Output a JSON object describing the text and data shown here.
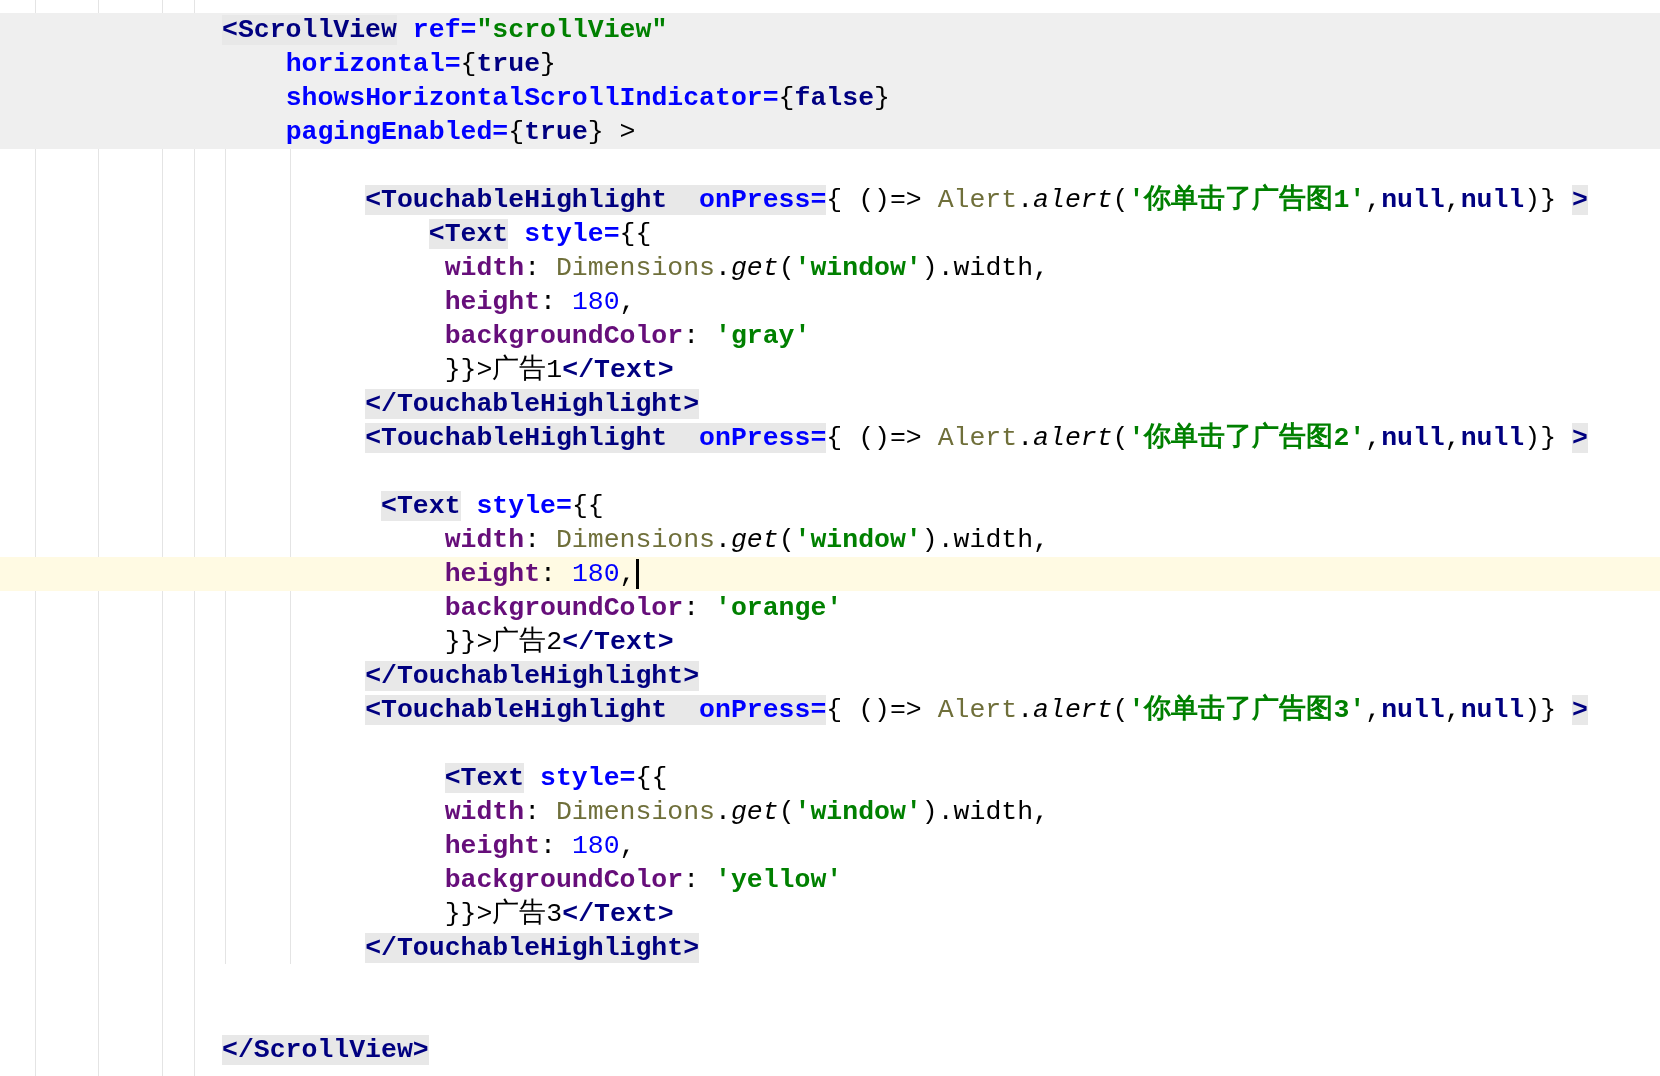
{
  "editor": {
    "lines": [
      {
        "current": false,
        "scope": true,
        "tokens": [
          {
            "kind": "tag",
            "t": "<ScrollView",
            "bg": true
          },
          {
            "kind": "attr",
            "t": " ref="
          },
          {
            "kind": "str",
            "t": "\"scrollView\""
          }
        ]
      },
      {
        "current": false,
        "scope": true,
        "tokens": [
          {
            "kind": "attr",
            "t": "    horizontal="
          },
          {
            "kind": "plain",
            "t": "{"
          },
          {
            "kind": "kw",
            "t": "true"
          },
          {
            "kind": "plain",
            "t": "}"
          }
        ]
      },
      {
        "current": false,
        "scope": true,
        "tokens": [
          {
            "kind": "attr",
            "t": "    showsHorizontalScrollIndicator="
          },
          {
            "kind": "plain",
            "t": "{"
          },
          {
            "kind": "kw",
            "t": "false"
          },
          {
            "kind": "plain",
            "t": "}"
          }
        ]
      },
      {
        "current": false,
        "scope": true,
        "tokens": [
          {
            "kind": "attr",
            "t": "    pagingEnabled="
          },
          {
            "kind": "plain",
            "t": "{"
          },
          {
            "kind": "kw",
            "t": "true"
          },
          {
            "kind": "plain",
            "t": "} >"
          }
        ]
      },
      {
        "current": false,
        "scope": false
      },
      {
        "current": false,
        "scope": false,
        "tokens": [
          {
            "kind": "tag",
            "t": "         <TouchableHighlight  ",
            "bg": true
          },
          {
            "kind": "attr",
            "t": "onPress=",
            "bg": true
          },
          {
            "kind": "plain",
            "t": "{ ()=> "
          },
          {
            "kind": "cls",
            "t": "Alert"
          },
          {
            "kind": "plain",
            "t": "."
          },
          {
            "kind": "method",
            "t": "alert"
          },
          {
            "kind": "plain",
            "t": "("
          },
          {
            "kind": "str",
            "t": "'你单击了广告图1'"
          },
          {
            "kind": "plain",
            "t": ","
          },
          {
            "kind": "kw",
            "t": "null"
          },
          {
            "kind": "plain",
            "t": ","
          },
          {
            "kind": "kw",
            "t": "null"
          },
          {
            "kind": "plain",
            "t": ")}"
          },
          {
            "kind": "tag",
            "t": " >",
            "bg": true
          }
        ]
      },
      {
        "current": false,
        "scope": false,
        "tokens": [
          {
            "kind": "tag",
            "t": "             <Text",
            "bg": true
          },
          {
            "kind": "attr",
            "t": " style="
          },
          {
            "kind": "plain",
            "t": "{{"
          }
        ]
      },
      {
        "current": false,
        "scope": false,
        "tokens": [
          {
            "kind": "prop",
            "t": "              width"
          },
          {
            "kind": "plain",
            "t": ": "
          },
          {
            "kind": "cls",
            "t": "Dimensions"
          },
          {
            "kind": "plain",
            "t": "."
          },
          {
            "kind": "method",
            "t": "get"
          },
          {
            "kind": "plain",
            "t": "("
          },
          {
            "kind": "str",
            "t": "'window'"
          },
          {
            "kind": "plain",
            "t": ").width,"
          }
        ]
      },
      {
        "current": false,
        "scope": false,
        "tokens": [
          {
            "kind": "prop",
            "t": "              height"
          },
          {
            "kind": "plain",
            "t": ": "
          },
          {
            "kind": "num",
            "t": "180"
          },
          {
            "kind": "plain",
            "t": ","
          }
        ]
      },
      {
        "current": false,
        "scope": false,
        "tokens": [
          {
            "kind": "prop",
            "t": "              backgroundColor"
          },
          {
            "kind": "plain",
            "t": ": "
          },
          {
            "kind": "str",
            "t": "'gray'"
          }
        ]
      },
      {
        "current": false,
        "scope": false,
        "tokens": [
          {
            "kind": "plain",
            "t": "              }}>广告1"
          },
          {
            "kind": "tag",
            "t": "</Text>"
          }
        ]
      },
      {
        "current": false,
        "scope": false,
        "tokens": [
          {
            "kind": "tag",
            "t": "         </TouchableHighlight>",
            "bg": true
          }
        ]
      },
      {
        "current": false,
        "scope": false,
        "tokens": [
          {
            "kind": "tag",
            "t": "         <TouchableHighlight  ",
            "bg": true
          },
          {
            "kind": "attr",
            "t": "onPress=",
            "bg": true
          },
          {
            "kind": "plain",
            "t": "{ ()=> "
          },
          {
            "kind": "cls",
            "t": "Alert"
          },
          {
            "kind": "plain",
            "t": "."
          },
          {
            "kind": "method",
            "t": "alert"
          },
          {
            "kind": "plain",
            "t": "("
          },
          {
            "kind": "str",
            "t": "'你单击了广告图2'"
          },
          {
            "kind": "plain",
            "t": ","
          },
          {
            "kind": "kw",
            "t": "null"
          },
          {
            "kind": "plain",
            "t": ","
          },
          {
            "kind": "kw",
            "t": "null"
          },
          {
            "kind": "plain",
            "t": ")}"
          },
          {
            "kind": "tag",
            "t": " >",
            "bg": true
          }
        ]
      },
      {
        "current": false,
        "scope": false
      },
      {
        "current": false,
        "scope": false,
        "tokens": [
          {
            "kind": "tag",
            "t": "          <Text",
            "bg": true
          },
          {
            "kind": "attr",
            "t": " style="
          },
          {
            "kind": "plain",
            "t": "{{"
          }
        ]
      },
      {
        "current": false,
        "scope": false,
        "tokens": [
          {
            "kind": "prop",
            "t": "              width"
          },
          {
            "kind": "plain",
            "t": ": "
          },
          {
            "kind": "cls",
            "t": "Dimensions"
          },
          {
            "kind": "plain",
            "t": "."
          },
          {
            "kind": "method",
            "t": "get"
          },
          {
            "kind": "plain",
            "t": "("
          },
          {
            "kind": "str",
            "t": "'window'"
          },
          {
            "kind": "plain",
            "t": ").width,"
          }
        ]
      },
      {
        "current": true,
        "scope": false,
        "tokens": [
          {
            "kind": "prop",
            "t": "              height"
          },
          {
            "kind": "plain",
            "t": ": "
          },
          {
            "kind": "num",
            "t": "180"
          },
          {
            "kind": "plain",
            "t": ","
          }
        ]
      },
      {
        "current": false,
        "scope": false,
        "tokens": [
          {
            "kind": "prop",
            "t": "              backgroundColor"
          },
          {
            "kind": "plain",
            "t": ": "
          },
          {
            "kind": "str",
            "t": "'orange'"
          }
        ]
      },
      {
        "current": false,
        "scope": false,
        "tokens": [
          {
            "kind": "plain",
            "t": "              }}>广告2"
          },
          {
            "kind": "tag",
            "t": "</Text>"
          }
        ]
      },
      {
        "current": false,
        "scope": false,
        "tokens": [
          {
            "kind": "tag",
            "t": "         </TouchableHighlight>",
            "bg": true
          }
        ]
      },
      {
        "current": false,
        "scope": false,
        "tokens": [
          {
            "kind": "tag",
            "t": "         <TouchableHighlight  ",
            "bg": true
          },
          {
            "kind": "attr",
            "t": "onPress=",
            "bg": true
          },
          {
            "kind": "plain",
            "t": "{ ()=> "
          },
          {
            "kind": "cls",
            "t": "Alert"
          },
          {
            "kind": "plain",
            "t": "."
          },
          {
            "kind": "method",
            "t": "alert"
          },
          {
            "kind": "plain",
            "t": "("
          },
          {
            "kind": "str",
            "t": "'你单击了广告图3'"
          },
          {
            "kind": "plain",
            "t": ","
          },
          {
            "kind": "kw",
            "t": "null"
          },
          {
            "kind": "plain",
            "t": ","
          },
          {
            "kind": "kw",
            "t": "null"
          },
          {
            "kind": "plain",
            "t": ")}"
          },
          {
            "kind": "tag",
            "t": " >",
            "bg": true
          }
        ]
      },
      {
        "current": false,
        "scope": false
      },
      {
        "current": false,
        "scope": false,
        "tokens": [
          {
            "kind": "tag",
            "t": "              <Text",
            "bg": true
          },
          {
            "kind": "attr",
            "t": " style="
          },
          {
            "kind": "plain",
            "t": "{{"
          }
        ]
      },
      {
        "current": false,
        "scope": false,
        "tokens": [
          {
            "kind": "prop",
            "t": "              width"
          },
          {
            "kind": "plain",
            "t": ": "
          },
          {
            "kind": "cls",
            "t": "Dimensions"
          },
          {
            "kind": "plain",
            "t": "."
          },
          {
            "kind": "method",
            "t": "get"
          },
          {
            "kind": "plain",
            "t": "("
          },
          {
            "kind": "str",
            "t": "'window'"
          },
          {
            "kind": "plain",
            "t": ").width,"
          }
        ]
      },
      {
        "current": false,
        "scope": false,
        "tokens": [
          {
            "kind": "prop",
            "t": "              height"
          },
          {
            "kind": "plain",
            "t": ": "
          },
          {
            "kind": "num",
            "t": "180"
          },
          {
            "kind": "plain",
            "t": ","
          }
        ]
      },
      {
        "current": false,
        "scope": false,
        "tokens": [
          {
            "kind": "prop",
            "t": "              backgroundColor"
          },
          {
            "kind": "plain",
            "t": ": "
          },
          {
            "kind": "str",
            "t": "'yellow'"
          }
        ]
      },
      {
        "current": false,
        "scope": false,
        "tokens": [
          {
            "kind": "plain",
            "t": "              }}>广告3"
          },
          {
            "kind": "tag",
            "t": "</Text>"
          }
        ]
      },
      {
        "current": false,
        "scope": false,
        "tokens": [
          {
            "kind": "tag",
            "t": "         </TouchableHighlight>",
            "bg": true
          }
        ]
      },
      {
        "current": false,
        "scope": false
      },
      {
        "current": false,
        "scope": false
      },
      {
        "current": false,
        "scope": false,
        "tokens": [
          {
            "kind": "tag",
            "t": "</ScrollView>",
            "bg": true
          }
        ]
      }
    ]
  }
}
